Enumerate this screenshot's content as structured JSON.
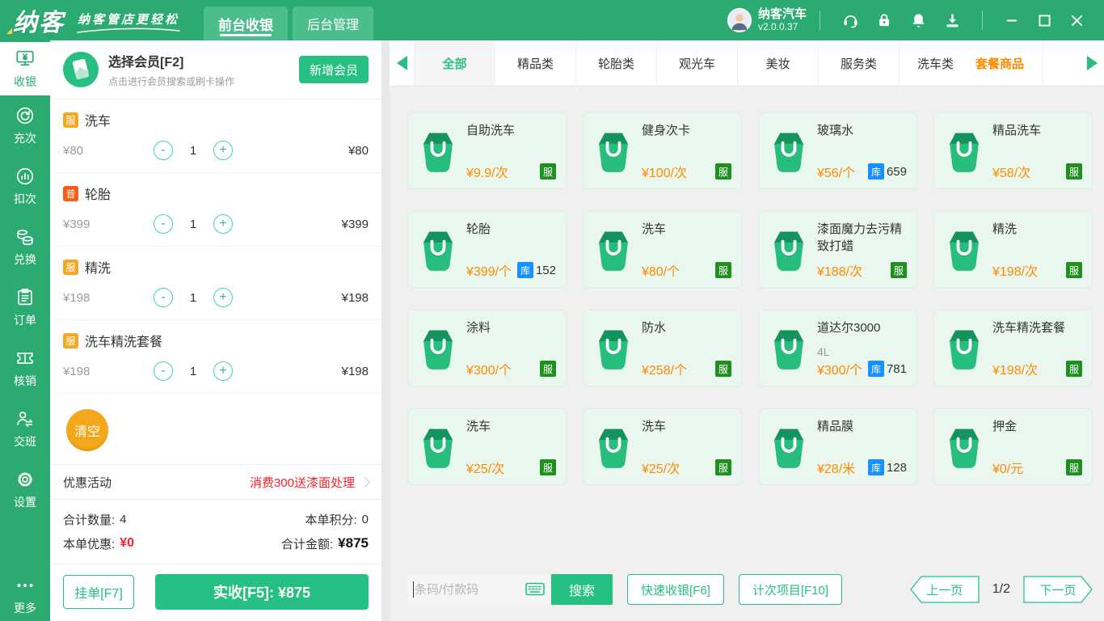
{
  "colors": {
    "brand_green": "#2bab72",
    "accent_green": "#27c082",
    "price_orange": "#ff8a00",
    "stock_blue": "#1890ff",
    "service_badge_green": "#1f8f1f",
    "danger_red": "#f5222d",
    "clear_orange": "#f5a71c"
  },
  "topbar": {
    "logo": "纳客",
    "slogan": "纳客管店更轻松",
    "tabs": [
      {
        "label": "前台收银",
        "active": true
      },
      {
        "label": "后台管理",
        "active": false
      }
    ],
    "user": {
      "name": "纳客汽车",
      "version": "v2.0.0.37"
    },
    "icons": [
      "customer-service-icon",
      "lock-icon",
      "bell-icon",
      "download-icon"
    ]
  },
  "sidebar": {
    "items": [
      {
        "label": "收银",
        "icon": "cashier-icon",
        "active": true
      },
      {
        "label": "充次",
        "icon": "recharge-times-icon",
        "active": false
      },
      {
        "label": "扣次",
        "icon": "deduct-times-icon",
        "active": false
      },
      {
        "label": "兑换",
        "icon": "exchange-icon",
        "active": false
      },
      {
        "label": "订单",
        "icon": "orders-icon",
        "active": false
      },
      {
        "label": "核销",
        "icon": "verify-icon",
        "active": false
      },
      {
        "label": "交班",
        "icon": "shift-icon",
        "active": false
      },
      {
        "label": "设置",
        "icon": "settings-icon",
        "active": false
      }
    ],
    "more": {
      "label": "更多",
      "icon": "more-icon"
    }
  },
  "cart": {
    "member": {
      "title": "选择会员[F2]",
      "subtitle": "点击进行会员搜索或刷卡操作",
      "add_button": "新增会员"
    },
    "stepper": {
      "minus": "-",
      "plus": "+"
    },
    "items": [
      {
        "badge": "服",
        "badge_type": "service",
        "name": "洗车",
        "price": "¥80",
        "qty": "1",
        "total": "¥80"
      },
      {
        "badge": "普",
        "badge_type": "normal",
        "name": "轮胎",
        "price": "¥399",
        "qty": "1",
        "total": "¥399"
      },
      {
        "badge": "服",
        "badge_type": "service",
        "name": "精洗",
        "price": "¥198",
        "qty": "1",
        "total": "¥198"
      },
      {
        "badge": "服",
        "badge_type": "service",
        "name": "洗车精洗套餐",
        "price": "¥198",
        "qty": "1",
        "total": "¥198"
      }
    ],
    "clear_button": "清空",
    "promo": {
      "label": "优惠活动",
      "value": "消费300送漆面处理"
    },
    "summary": {
      "qty_label": "合计数量:",
      "qty": "4",
      "points_label": "本单积分:",
      "points": "0",
      "discount_label": "本单优惠:",
      "discount": "¥0",
      "total_label": "合计金额:",
      "total": "¥875"
    },
    "hold_button": "挂单[F7]",
    "pay_button": "实收[F5]:  ¥875"
  },
  "catalog": {
    "categories": [
      {
        "label": "全部",
        "active": true
      },
      {
        "label": "精品类"
      },
      {
        "label": "轮胎类"
      },
      {
        "label": "观光车"
      },
      {
        "label": "美妆"
      },
      {
        "label": "服务类"
      },
      {
        "label": "洗车类",
        "clipped": true
      },
      {
        "label": "套餐商品",
        "highlight": true
      }
    ],
    "products": [
      {
        "name": "自助洗车",
        "price": "¥9.9/次",
        "badge": "服"
      },
      {
        "name": "健身次卡",
        "price": "¥100/次",
        "badge": "服"
      },
      {
        "name": "玻璃水",
        "price": "¥56/个",
        "badge": "库",
        "stock": "659"
      },
      {
        "name": "精品洗车",
        "price": "¥58/次",
        "badge": "服"
      },
      {
        "name": "轮胎",
        "price": "¥399/个",
        "badge": "库",
        "stock": "152"
      },
      {
        "name": "洗车",
        "price": "¥80/个",
        "badge": "服"
      },
      {
        "name": "漆面魔力去污精致打蜡",
        "price": "¥188/次",
        "badge": "服"
      },
      {
        "name": "精洗",
        "price": "¥198/次",
        "badge": "服"
      },
      {
        "name": "涂料",
        "price": "¥300/个",
        "badge": "服"
      },
      {
        "name": "防水",
        "price": "¥258/个",
        "badge": "服"
      },
      {
        "name": "道达尔3000",
        "subtitle": "4L",
        "price": "¥300/个",
        "badge": "库",
        "stock": "781"
      },
      {
        "name": "洗车精洗套餐",
        "price": "¥198/次",
        "badge": "服"
      },
      {
        "name": "洗车",
        "price": "¥25/次",
        "badge": "服"
      },
      {
        "name": "洗车",
        "price": "¥25/次",
        "badge": "服"
      },
      {
        "name": "精品膜",
        "price": "¥28/米",
        "badge": "库",
        "stock": "128"
      },
      {
        "name": "押金",
        "price": "¥0/元",
        "badge": "服"
      }
    ],
    "search": {
      "placeholder": "条码/付款码",
      "button": "搜索"
    },
    "quick_buttons": [
      "快速收银[F6]",
      "计次项目[F10]"
    ],
    "pagination": {
      "prev": "上一页",
      "current": "1/2",
      "next": "下一页"
    }
  }
}
